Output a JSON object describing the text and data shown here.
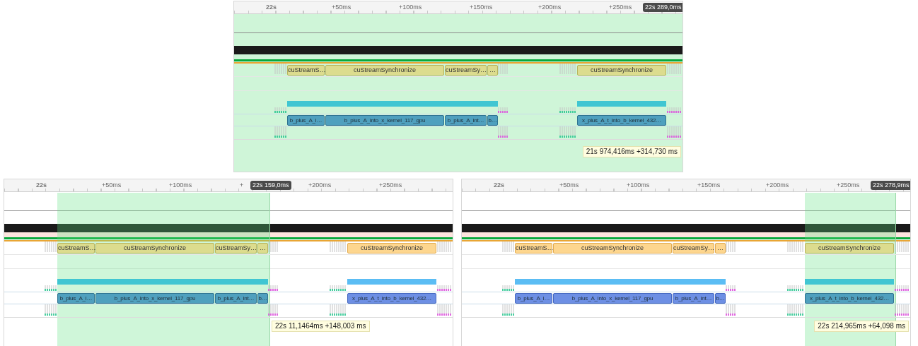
{
  "panels": [
    {
      "whole_range_selected": true,
      "ruler": {
        "ticks": [
          "22s",
          "+50ms",
          "+100ms",
          "+150ms",
          "+200ms",
          "+250ms"
        ],
        "cursor": "22s 289,0ms"
      },
      "api_calls": [
        {
          "label": "cuStreamS…",
          "selected": true
        },
        {
          "label": "cuStreamSynchronize",
          "selected": true
        },
        {
          "label": "cuStreamSy…",
          "selected": true
        },
        {
          "label": "…",
          "selected": true
        },
        {
          "label": "cuStreamSynchronize",
          "selected": true
        }
      ],
      "gpu_activity": [
        {
          "selected": true
        },
        {
          "selected": true
        }
      ],
      "kernels": [
        {
          "label": "b_plus_A_i…",
          "selected": true
        },
        {
          "label": "b_plus_A_into_x_kernel_117_gpu",
          "selected": true
        },
        {
          "label": "b_plus_A_int…",
          "selected": true
        },
        {
          "label": "b…",
          "selected": true
        },
        {
          "label": "x_plus_A_t_into_b_kernel_432…",
          "selected": true
        }
      ],
      "tooltip": "21s 974,416ms +314,730 ms"
    },
    {
      "whole_range_selected": false,
      "ruler": {
        "ticks": [
          "22s",
          "+50ms",
          "+100ms",
          "+",
          "+200ms",
          "+250ms"
        ],
        "cursor": "22s 159,0ms"
      },
      "api_calls": [
        {
          "label": "cuStreamS…",
          "selected": true
        },
        {
          "label": "cuStreamSynchronize",
          "selected": true
        },
        {
          "label": "cuStreamSy…",
          "selected": true
        },
        {
          "label": "…",
          "selected": true
        },
        {
          "label": "cuStreamSynchronize",
          "selected": false
        }
      ],
      "gpu_activity": [
        {
          "selected": true
        },
        {
          "selected": false
        }
      ],
      "kernels": [
        {
          "label": "b_plus_A_i…",
          "selected": true
        },
        {
          "label": "b_plus_A_into_x_kernel_117_gpu",
          "selected": true
        },
        {
          "label": "b_plus_A_int…",
          "selected": true
        },
        {
          "label": "b…",
          "selected": true
        },
        {
          "label": "x_plus_A_t_into_b_kernel_432…",
          "selected": false
        }
      ],
      "tooltip": "22s 11,1464ms +148,003 ms"
    },
    {
      "whole_range_selected": false,
      "ruler": {
        "ticks": [
          "22s",
          "+50ms",
          "+100ms",
          "+150ms",
          "+200ms",
          "+250ms"
        ],
        "cursor": "22s 278,9ms"
      },
      "api_calls": [
        {
          "label": "cuStreamS…",
          "selected": false
        },
        {
          "label": "cuStreamSynchronize",
          "selected": false
        },
        {
          "label": "cuStreamSy…",
          "selected": false
        },
        {
          "label": "…",
          "selected": false
        },
        {
          "label": "cuStreamSynchronize",
          "selected": true
        }
      ],
      "gpu_activity": [
        {
          "selected": false
        },
        {
          "selected": true
        }
      ],
      "kernels": [
        {
          "label": "b_plus_A_i…",
          "selected": false
        },
        {
          "label": "b_plus_A_into_x_kernel_117_gpu",
          "selected": false
        },
        {
          "label": "b_plus_A_int…",
          "selected": false
        },
        {
          "label": "b…",
          "selected": false
        },
        {
          "label": "x_plus_A_t_into_b_kernel_432…",
          "selected": true
        }
      ],
      "tooltip": "22s 214,965ms +64,098 ms"
    }
  ]
}
